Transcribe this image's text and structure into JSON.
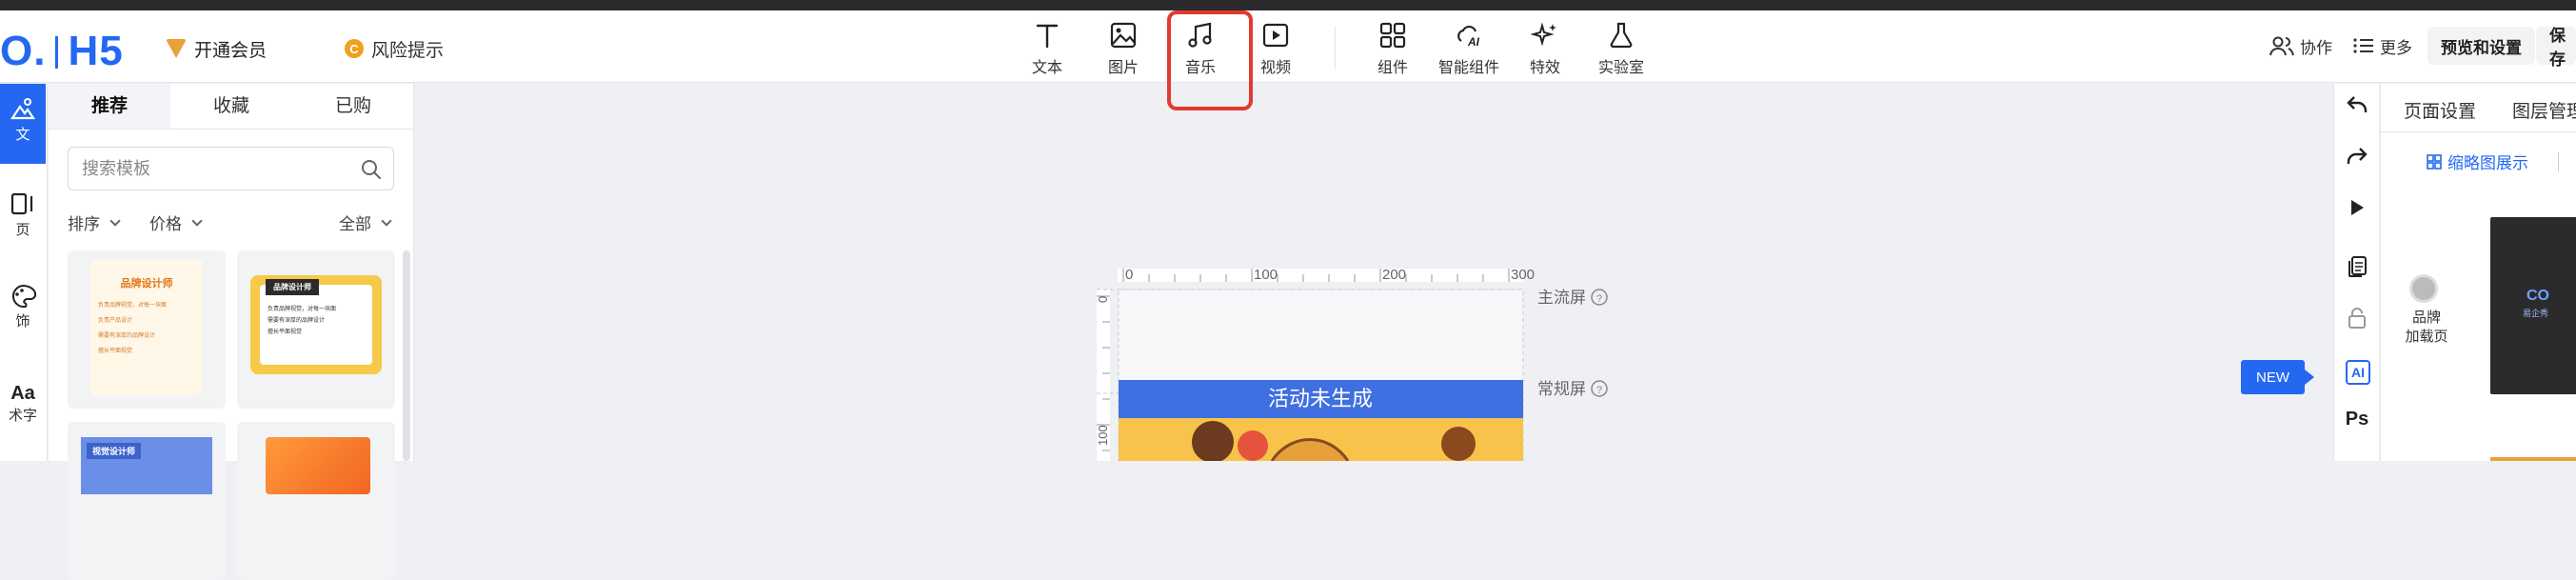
{
  "header": {
    "logo_text": "O.",
    "logo_suffix": "H5",
    "vip_label": "开通会员",
    "risk_label": "风险提示",
    "risk_icon_letter": "C"
  },
  "toolbar": {
    "items": [
      {
        "label": "文本",
        "icon": "text-icon"
      },
      {
        "label": "图片",
        "icon": "image-icon"
      },
      {
        "label": "音乐",
        "icon": "music-icon"
      },
      {
        "label": "视频",
        "icon": "video-icon"
      },
      {
        "label": "组件",
        "icon": "component-icon"
      },
      {
        "label": "智能组件",
        "icon": "ai-component-icon"
      },
      {
        "label": "特效",
        "icon": "sparkle-icon"
      },
      {
        "label": "实验室",
        "icon": "flask-icon"
      }
    ],
    "collab_label": "协作",
    "more_label": "更多",
    "preview_label": "预览和设置",
    "save_label": "保存"
  },
  "left_rail": {
    "items": [
      {
        "label": "文",
        "icon": "template-icon",
        "active": true
      },
      {
        "label": "页",
        "icon": "page-icon"
      },
      {
        "label": "饰",
        "icon": "decoration-icon"
      },
      {
        "label": "术字",
        "icon": "art-text-icon",
        "glyph": "Aa"
      }
    ]
  },
  "template_panel": {
    "tabs": [
      "推荐",
      "收藏",
      "已购"
    ],
    "active_tab": "推荐",
    "search_placeholder": "搜索模板",
    "filters": {
      "sort": "排序",
      "price": "价格",
      "all": "全部"
    },
    "cards": [
      {
        "title": "品牌设计师",
        "lines": [
          "负责品牌视觉，对每一块面",
          "负责产品设计",
          "需要有深厚的品牌设计",
          "擅长平面视觉"
        ]
      },
      {
        "title": "品牌设计师",
        "lines": [
          "负责品牌视觉，对每一块面",
          "需要有深厚的品牌设计",
          "擅长平面视觉"
        ]
      },
      {
        "title": "视觉设计师",
        "lines": []
      },
      {
        "title": "",
        "lines": []
      }
    ]
  },
  "canvas": {
    "ruler_ticks_x": [
      "0",
      "100",
      "200",
      "300"
    ],
    "ruler_ticks_y": [
      "0",
      "100"
    ],
    "main_screen_label": "主流屏",
    "normal_screen_label": "常规屏",
    "help_glyph": "?",
    "banner_text": "活动未生成"
  },
  "right_rail": {
    "ai_label": "AI",
    "ps_label": "Ps"
  },
  "right_panel": {
    "tabs": [
      "页面设置",
      "图层管理"
    ],
    "thumbnail_toggle": "缩略图展示",
    "page_label": "品牌\n加载页",
    "thumb_brand": "CO",
    "thumb_caption": "易企秀"
  },
  "new_badge": "NEW",
  "colors": {
    "accent": "#2468f2",
    "highlight": "#e33b2f",
    "vip": "#e9a23b",
    "banner": "#3f6fe0"
  }
}
